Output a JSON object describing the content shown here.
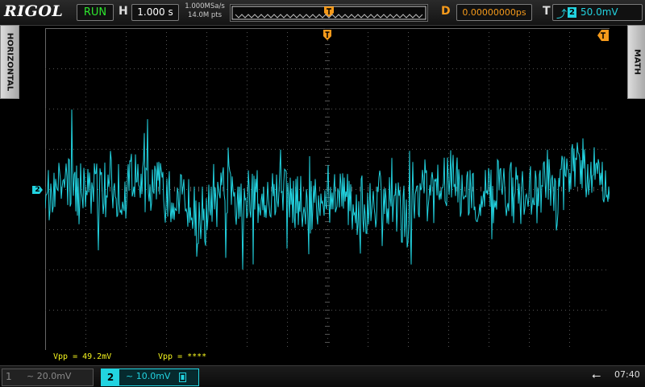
{
  "brand": "RIGOL",
  "run_state": "RUN",
  "horizontal": {
    "label": "H",
    "timebase": "1.000 s",
    "sample_rate": "1.000MSa/s",
    "memory_depth": "14.0M pts"
  },
  "delay": {
    "label": "D",
    "value": "0.00000000ps"
  },
  "trigger": {
    "label": "T",
    "edge_icon": "rising-edge-icon",
    "source": "2",
    "level": "50.0mV"
  },
  "side_tabs": {
    "left": "HORIZONTAL",
    "right": "MATH"
  },
  "channel_marker": "2",
  "measurements": [
    "Vpp = 49.2mV",
    "Vpp = ****"
  ],
  "channels": [
    {
      "number": "1",
      "scale": "~ 20.0mV",
      "active": false
    },
    {
      "number": "2",
      "scale": "~ 10.0mV",
      "active": true
    }
  ],
  "status": {
    "usb_icon": "usb-icon",
    "clock": "07:40"
  },
  "colors": {
    "ch2": "#22d3e0",
    "run": "#2ee62e",
    "delay": "#f59a1b",
    "measure": "#f5f51e"
  }
}
